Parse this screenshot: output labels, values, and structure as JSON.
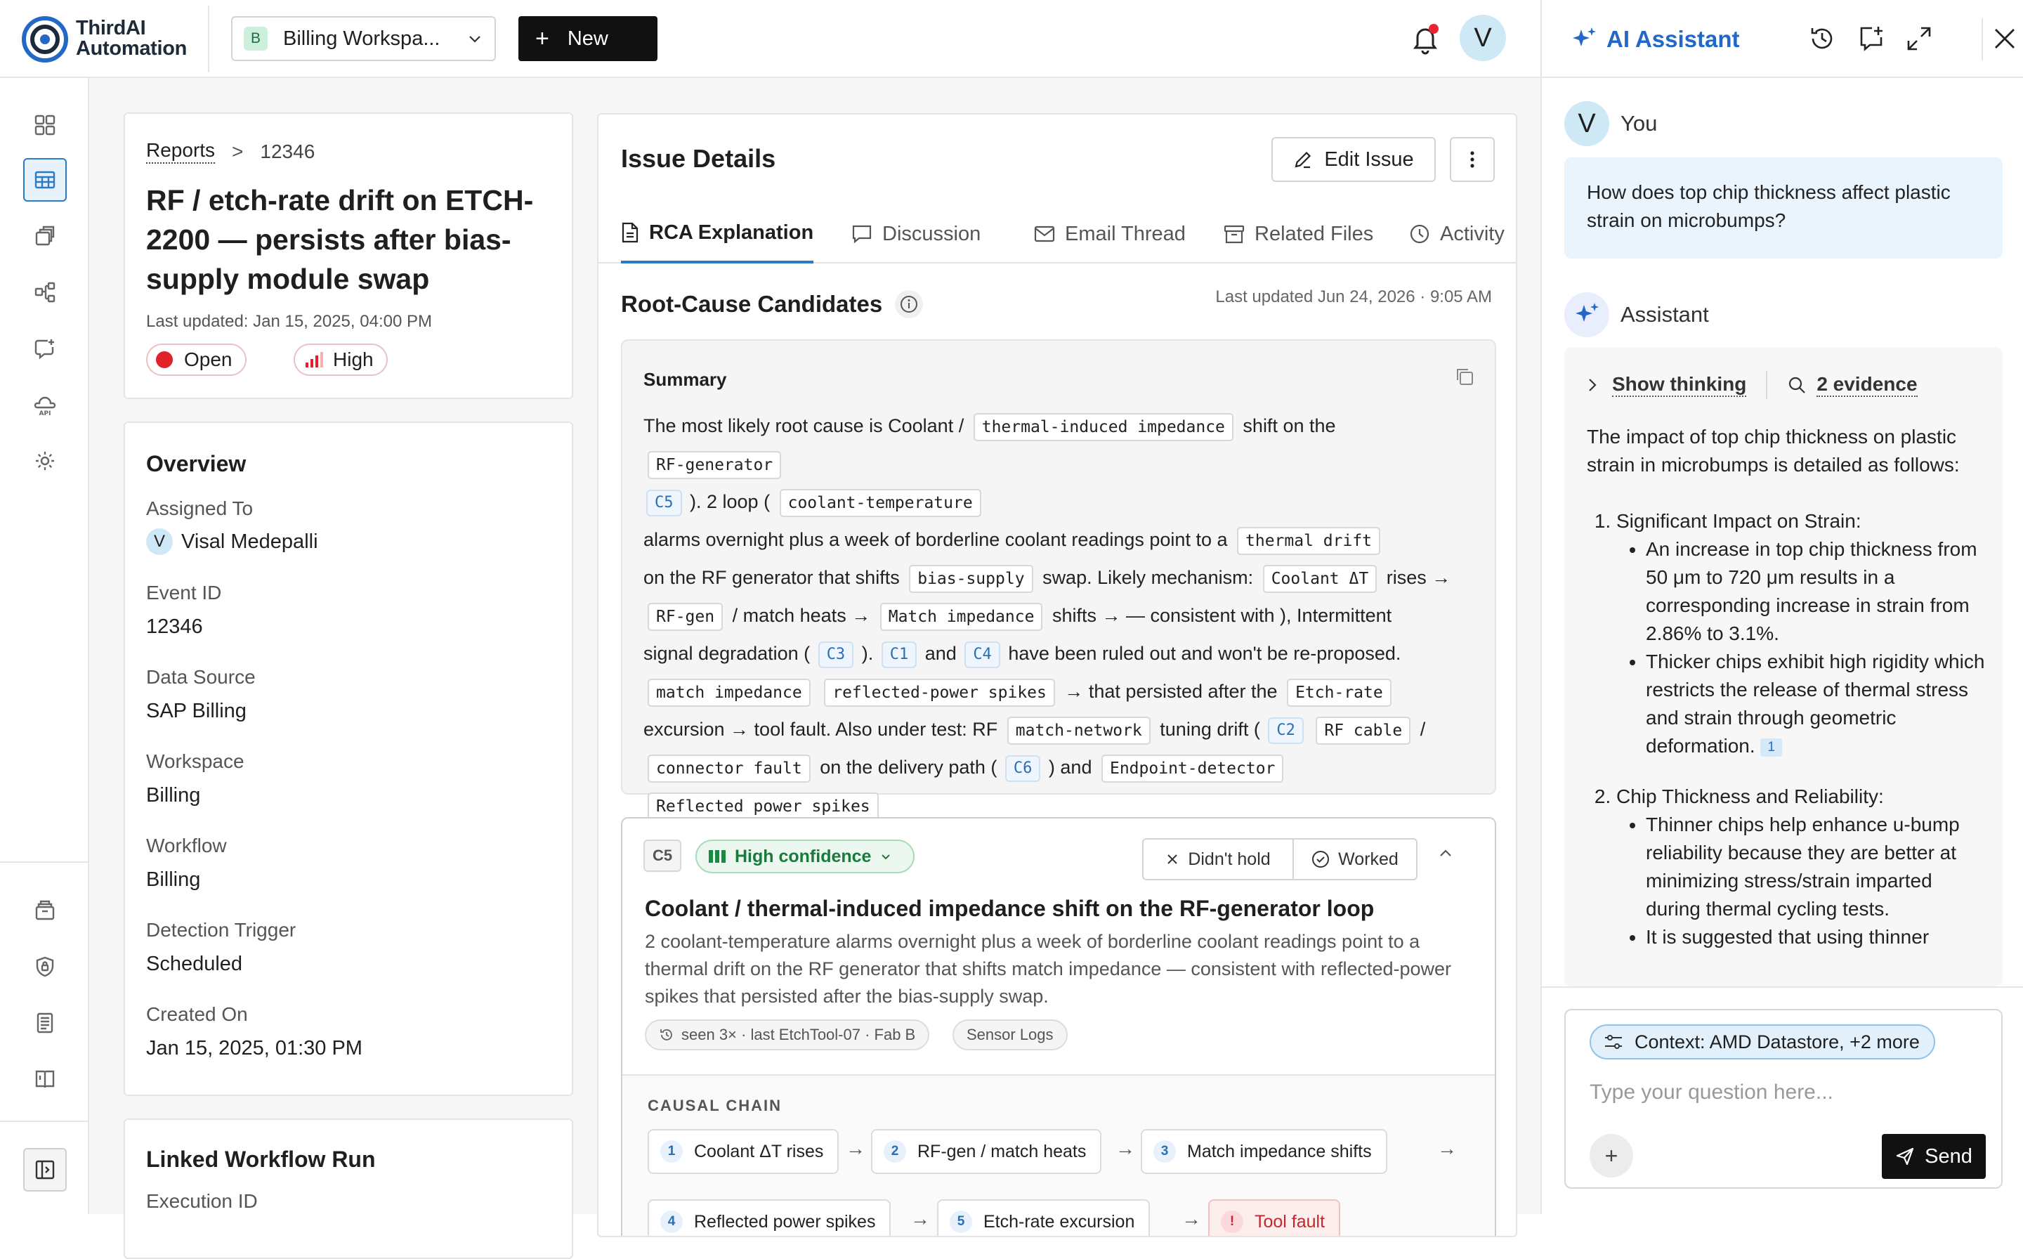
{
  "brand": {
    "line1": "ThirdAI",
    "line2": "Automation"
  },
  "workspace": {
    "badge": "B",
    "label": "Billing Workspa..."
  },
  "new_button": {
    "plus": "+",
    "label": "New"
  },
  "user_avatar": "V",
  "sidebar": {
    "items": [
      {
        "icon": "grid-icon"
      },
      {
        "icon": "table-icon",
        "active": true
      },
      {
        "icon": "stack-icon"
      },
      {
        "icon": "workflow-icon"
      },
      {
        "icon": "chat-alert-icon"
      },
      {
        "icon": "api-icon"
      },
      {
        "icon": "settings-icon"
      },
      {
        "icon": "archive-icon"
      },
      {
        "icon": "shield-icon"
      },
      {
        "icon": "ledger-icon"
      },
      {
        "icon": "book-icon"
      }
    ]
  },
  "issue": {
    "breadcrumb": {
      "parent": "Reports",
      "sep": ">",
      "current": "12346"
    },
    "title": "RF / etch-rate drift on ETCH-2200 — persists after bias-supply module swap",
    "updated": "Last updated: Jan 15, 2025, 04:00 PM",
    "status": "Open",
    "priority": "High"
  },
  "overview": {
    "heading": "Overview",
    "assigned_label": "Assigned To",
    "assigned_initial": "V",
    "assigned_value": "Visal Medepalli",
    "event_label": "Event ID",
    "event_value": "12346",
    "source_label": "Data Source",
    "source_value": "SAP Billing",
    "workspace_label": "Workspace",
    "workspace_value": "Billing",
    "workflow_label": "Workflow",
    "workflow_value": "Billing",
    "trigger_label": "Detection Trigger",
    "trigger_value": "Scheduled",
    "created_label": "Created On",
    "created_value": "Jan 15, 2025, 01:30 PM"
  },
  "linked": {
    "heading": "Linked Workflow Run",
    "sub": "Execution ID"
  },
  "details": {
    "heading": "Issue Details",
    "edit_label": "Edit Issue",
    "tabs": [
      "RCA Explanation",
      "Discussion",
      "Email Thread",
      "Related Files",
      "Activity"
    ],
    "rc_heading": "Root-Cause Candidates",
    "rc_updated": "Last updated Jun 24, 2026 · 9:05 AM"
  },
  "summary": {
    "heading": "Summary",
    "t1": "The most likely root cause is Coolant /",
    "c1": "thermal-induced impedance",
    "t2": "shift on the",
    "c2": "RF-generator",
    "r1": "C5",
    "t3": "). 2  loop (",
    "c3": "coolant-temperature",
    "t4": "alarms overnight plus a week of borderline coolant readings point to a",
    "c4": "thermal drift",
    "t5": "on the RF generator that shifts",
    "c5": "bias-supply",
    "t6": "swap. Likely mechanism:",
    "c6": "Coolant ΔT",
    "t7": "rises →",
    "c7": "RF-gen",
    "t8": "/ match heats →",
    "c8": "Match impedance",
    "t9": "shifts →  — consistent with ), Intermittent",
    "t10": "signal degradation (",
    "r2": "C3",
    "t11": ").",
    "r3": "C1",
    "t12": "and",
    "r4": "C4",
    "t13": "have been ruled out and won't be re-proposed.",
    "c9": "match impedance",
    "c10": "reflected-power spikes",
    "t14": "→  that persisted after the",
    "c11": "Etch-rate",
    "t15": "excursion → tool fault. Also under test: RF",
    "c12": "match-network",
    "t16": "tuning drift (",
    "r5": "C2",
    "c13": "RF cable",
    "t17": "/",
    "c14": "connector fault",
    "t18": "on the delivery path (",
    "r6": "C6",
    "t19": ") and",
    "c15": "Endpoint-detector",
    "c16": "Reflected power spikes"
  },
  "candidate": {
    "id": "C5",
    "confidence": "High confidence",
    "didnt_hold": "Didn't hold",
    "worked": "Worked",
    "title": "Coolant / thermal-induced impedance shift on the RF-generator loop",
    "description": "2 coolant-temperature alarms overnight plus a week of borderline coolant readings point to a thermal drift on the RF generator that shifts match impedance — consistent with reflected-power spikes that persisted after the bias-supply swap.",
    "tag_seen": "seen 3× · last EtchTool-07 · Fab B",
    "tag_source": "Sensor Logs",
    "chain_heading": "CAUSAL CHAIN",
    "chain": [
      {
        "n": "1",
        "label": "Coolant ΔT rises"
      },
      {
        "n": "2",
        "label": "RF-gen / match heats"
      },
      {
        "n": "3",
        "label": "Match impedance shifts"
      },
      {
        "n": "4",
        "label": "Reflected power spikes"
      },
      {
        "n": "5",
        "label": "Etch-rate excursion"
      },
      {
        "n": "!",
        "label": "Tool fault"
      }
    ],
    "arrow": "→"
  },
  "assistant": {
    "title": "AI Assistant",
    "you_initial": "V",
    "you_label": "You",
    "question": "How does top chip thickness affect plastic strain on microbumps?",
    "ai_label": "Assistant",
    "show_thinking": "Show thinking",
    "evidence": "2 evidence",
    "intro": "The impact of top chip thickness on plastic strain in microbumps is detailed as follows:",
    "p1_title": "Significant Impact on Strain:",
    "p1_b1": "An increase in top chip thickness from 50 μm to 720 μm results in a corresponding increase in strain from 2.86% to 3.1%.",
    "p1_b2": "Thicker chips exhibit high rigidity which restricts the release of thermal stress and strain through geometric deformation.",
    "cite": "1",
    "p2_title": "Chip Thickness and Reliability:",
    "p2_b1": "Thinner chips help enhance u-bump reliability because they are better at minimizing stress/strain imparted during thermal cycling tests.",
    "p2_b2": "It is suggested that using thinner",
    "context": "Context: AMD Datastore, +2 more",
    "placeholder": "Type your question here...",
    "plus": "+",
    "send": "Send"
  }
}
